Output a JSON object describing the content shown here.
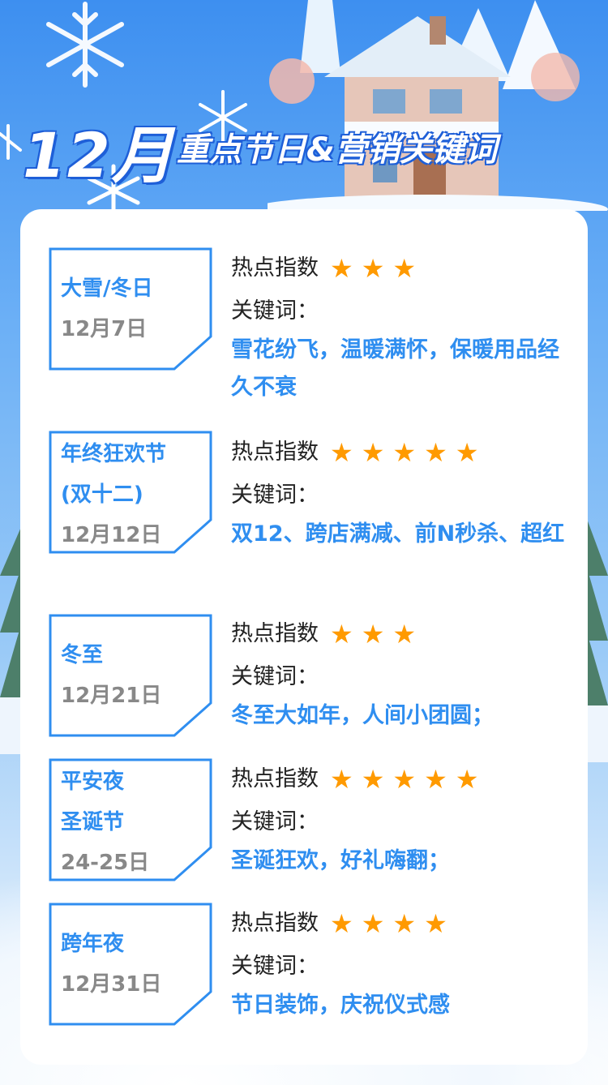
{
  "title": {
    "big": "12月",
    "rest": "重点节日&营销关键词"
  },
  "hot_label": "热点指数",
  "kw_label": "关键词：",
  "star_glyph": "★",
  "colors": {
    "accent": "#2f8ef0",
    "star": "#ff9a00",
    "date": "#888888"
  },
  "items": [
    {
      "name_lines": [
        "大雪/冬日"
      ],
      "date": "12月7日",
      "stars": 3,
      "keywords": "雪花纷飞，温暖满怀，保暖用品经久不衰"
    },
    {
      "name_lines": [
        "年终狂欢节",
        "(双十二)"
      ],
      "date": "12月12日",
      "stars": 5,
      "keywords": "双12、跨店满减、前N秒杀、超红"
    },
    {
      "name_lines": [
        "冬至"
      ],
      "date": "12月21日",
      "stars": 3,
      "keywords": "冬至大如年，人间小团圆；"
    },
    {
      "name_lines": [
        "平安夜",
        "圣诞节"
      ],
      "date": "24-25日",
      "stars": 5,
      "keywords": "圣诞狂欢，好礼嗨翻；"
    },
    {
      "name_lines": [
        "跨年夜"
      ],
      "date": "12月31日",
      "stars": 4,
      "keywords": "节日装饰，庆祝仪式感"
    }
  ]
}
